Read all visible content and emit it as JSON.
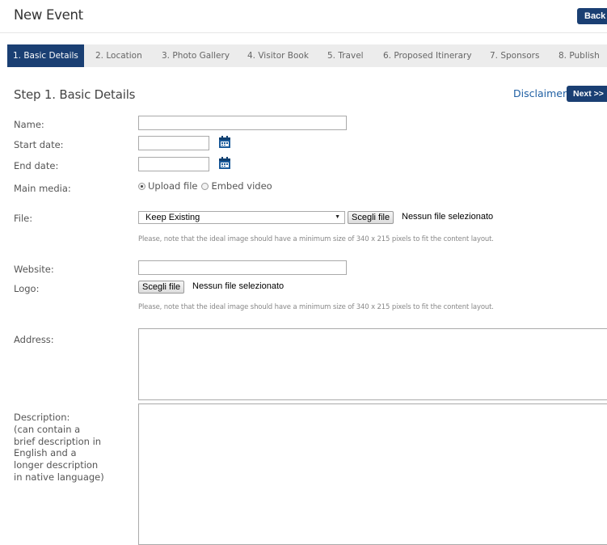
{
  "header": {
    "title": "New Event",
    "back_label": "Back"
  },
  "tabs": [
    {
      "label": "1. Basic Details"
    },
    {
      "label": "2. Location"
    },
    {
      "label": "3. Photo Gallery"
    },
    {
      "label": "4. Visitor Book"
    },
    {
      "label": "5. Travel"
    },
    {
      "label": "6. Proposed Itinerary"
    },
    {
      "label": "7. Sponsors"
    },
    {
      "label": "8. Publish"
    }
  ],
  "step": {
    "title": "Step 1. Basic Details",
    "disclaimer": "Disclaimer",
    "next_label": "Next >>"
  },
  "form": {
    "name_label": "Name:",
    "start_label": "Start date:",
    "end_label": "End date:",
    "media_label": "Main media:",
    "upload_option": "Upload file",
    "embed_option": "Embed video",
    "file_label": "File:",
    "file_select_value": "Keep Existing",
    "choose_file_label": "Scegli file",
    "no_file_text": "Nessun file selezionato",
    "hint": "Please, note that the ideal image should have a minimum size of 340 x 215 pixels to fit the content layout.",
    "website_label": "Website:",
    "logo_label": "Logo:",
    "address_label": "Address:",
    "description_lines": [
      "Description:",
      "(can contain a",
      "brief description in",
      "English and a",
      "longer description",
      "in native language)"
    ]
  },
  "colors": {
    "primary": "#1a3f73",
    "link": "#1f5fa3",
    "tab_bg": "#ececec",
    "calendar_icon": "#1a5a9a"
  }
}
